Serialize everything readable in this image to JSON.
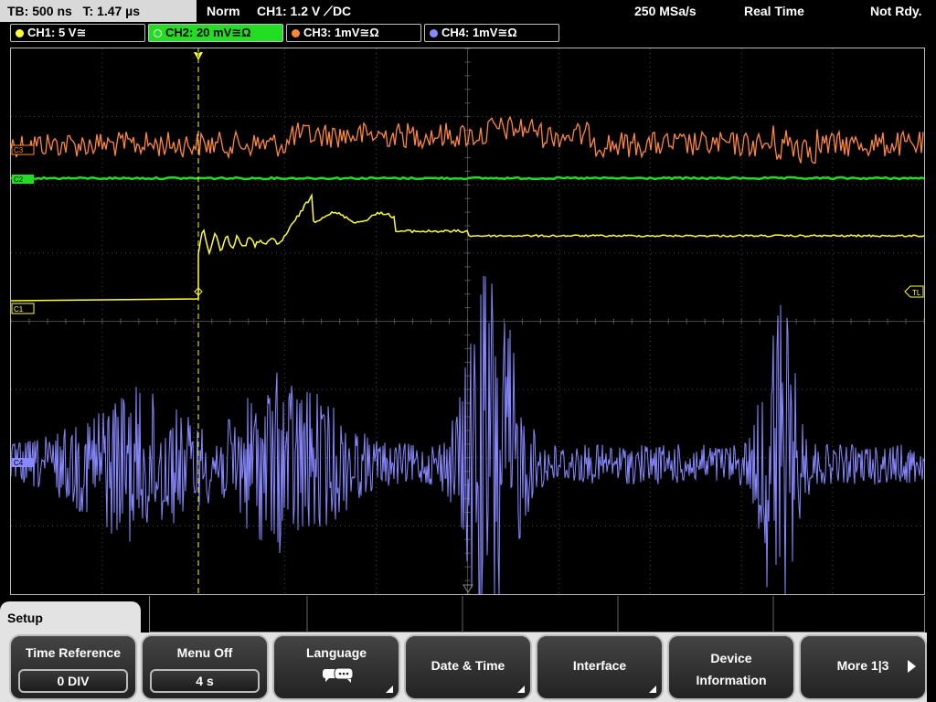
{
  "status": {
    "timebase": "TB: 500 ns",
    "trigger_time": "T: 1.47 µs",
    "trigger_mode": "Norm",
    "trigger_info": "CH1: 1.2 V ⟋DC",
    "sample_rate": "250 MSa/s",
    "acq_mode": "Real Time",
    "acq_state": "Not Rdy."
  },
  "channels": [
    {
      "label": "CH1: 5 V≅",
      "color": "#ffff33",
      "active": false
    },
    {
      "label": "CH2: 20 mV≅Ω",
      "color": "#22dd22",
      "active": true
    },
    {
      "label": "CH3: 1mV≅Ω",
      "color": "#ff8833",
      "active": false
    },
    {
      "label": "CH4: 1mV≅Ω",
      "color": "#8888ff",
      "active": false
    }
  ],
  "markers": {
    "c3": "C3",
    "c2": "C2",
    "c1": "C1",
    "c4": "C4",
    "trigger_level": "TL",
    "trigger_position": "T"
  },
  "menu": {
    "title": "Setup",
    "softkeys": [
      {
        "label": "Time Reference",
        "value": "0 DIV"
      },
      {
        "label": "Menu Off",
        "value": "4 s"
      },
      {
        "label": "Language",
        "icon": "speech-bubbles-icon"
      },
      {
        "label": "Date & Time"
      },
      {
        "label": "Interface"
      },
      {
        "label": "Device Information"
      },
      {
        "label": "More 1|3"
      }
    ]
  },
  "scope_data": {
    "grid": {
      "h_divs": 10,
      "v_divs": 8
    },
    "trigger_position_div": 2.1
  }
}
